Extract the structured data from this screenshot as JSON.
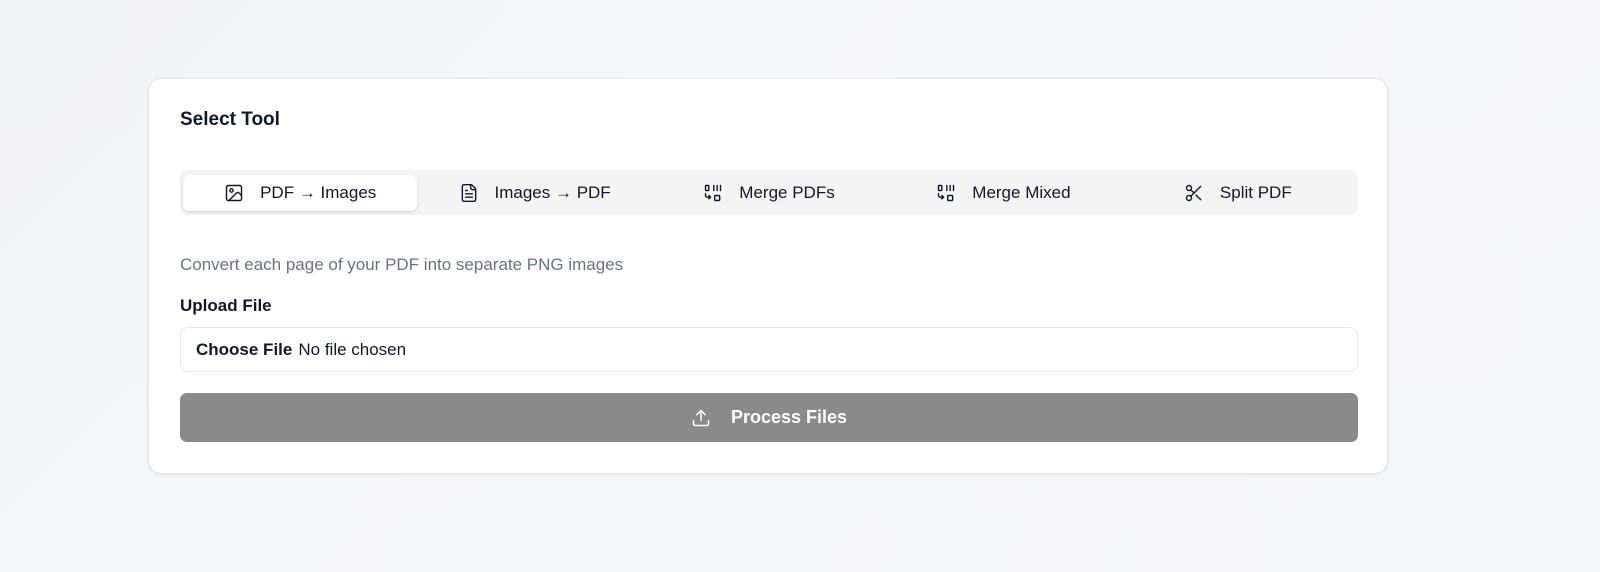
{
  "card": {
    "title": "Select Tool"
  },
  "tabs": [
    {
      "label": "PDF → Images",
      "icon": "image-icon",
      "active": true
    },
    {
      "label": "Images → PDF",
      "icon": "file-text-icon",
      "active": false
    },
    {
      "label": "Merge PDFs",
      "icon": "merge-icon",
      "active": false
    },
    {
      "label": "Merge Mixed",
      "icon": "merge-icon",
      "active": false
    },
    {
      "label": "Split PDF",
      "icon": "scissors-icon",
      "active": false
    }
  ],
  "tool": {
    "description": "Convert each page of your PDF into separate PNG images"
  },
  "upload": {
    "label": "Upload File",
    "choose_button": "Choose File",
    "status": "No file chosen"
  },
  "process": {
    "label": "Process Files",
    "icon": "upload-icon",
    "disabled": true
  },
  "colors": {
    "process_button_bg": "#8a8a8a",
    "description_text": "#6b7280",
    "tab_bar_bg": "#f4f4f5"
  }
}
